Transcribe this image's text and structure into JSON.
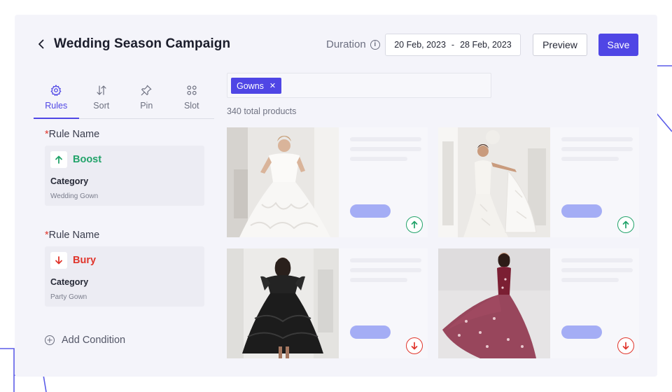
{
  "header": {
    "title": "Wedding Season Campaign",
    "duration_label": "Duration",
    "date_start": "20 Feb, 2023",
    "date_separator": "-",
    "date_end": "28 Feb, 2023",
    "preview_label": "Preview",
    "save_label": "Save"
  },
  "tabs": [
    {
      "label": "Rules",
      "icon": "gear-icon",
      "active": true
    },
    {
      "label": "Sort",
      "icon": "sort-arrows-icon",
      "active": false
    },
    {
      "label": "Pin",
      "icon": "pin-icon",
      "active": false
    },
    {
      "label": "Slot",
      "icon": "grid-circles-icon",
      "active": false
    }
  ],
  "rules": [
    {
      "required_mark": "*",
      "name_label": "Rule Name",
      "action": "Boost",
      "category_label": "Category",
      "category_value": "Wedding Gown"
    },
    {
      "required_mark": "*",
      "name_label": "Rule Name",
      "action": "Bury",
      "category_label": "Category",
      "category_value": "Party Gown"
    }
  ],
  "add_condition_label": "Add Condition",
  "filter": {
    "chip_label": "Gowns",
    "chip_close": "✕"
  },
  "total_products": "340 total products",
  "products": [
    {
      "image": "white-ballgown-photo",
      "rank": "up"
    },
    {
      "image": "white-lace-mermaid-gown-photo",
      "rank": "up"
    },
    {
      "image": "black-ruffle-gown-photo",
      "rank": "down"
    },
    {
      "image": "burgundy-tulle-gown-photo",
      "rank": "down"
    }
  ],
  "colors": {
    "accent": "#4f46e5",
    "boost": "#22a36a",
    "bury": "#e0352b"
  }
}
